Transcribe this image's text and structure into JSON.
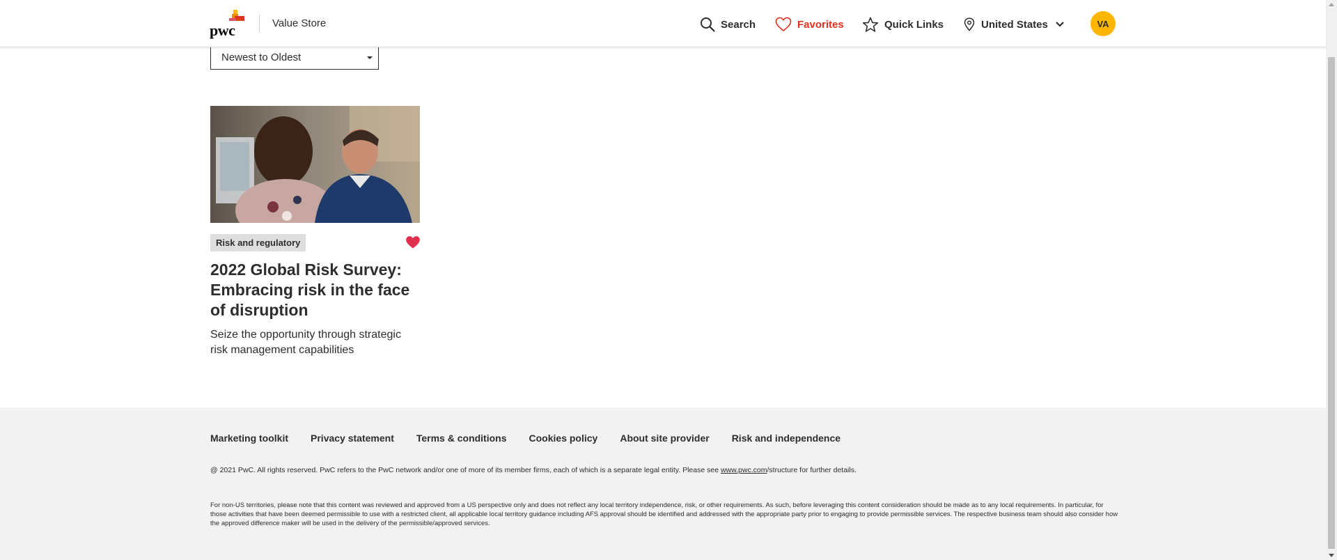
{
  "header": {
    "logo_text": "pwc",
    "store_name": "Value Store",
    "nav": {
      "search_label": "Search",
      "favorites_label": "Favorites",
      "quick_links_label": "Quick Links",
      "country_label": "United States"
    },
    "avatar_initials": "VA",
    "colors": {
      "accent": "#e0301e",
      "avatar": "#ffb600"
    }
  },
  "sort": {
    "selected": "Newest to Oldest"
  },
  "card": {
    "tag": "Risk and regulatory",
    "title": "2022 Global Risk Survey: Embracing risk in the face of disruption",
    "description": "Seize the opportunity through strategic risk management capabilities",
    "favorited": true
  },
  "footer": {
    "links": [
      "Marketing toolkit",
      "Privacy statement",
      "Terms & conditions",
      "Cookies policy",
      "About site provider",
      "Risk and independence"
    ],
    "copyright_before": "@ 2021 PwC. All rights reserved. PwC refers to the PwC network and/or one of more of its member firms, each of which is a separate legal entity. Please see ",
    "copyright_link": "www.pwc.com",
    "copyright_after": "/structure for further details.",
    "disclaimer": "For non-US territories, please note that this content was reviewed and approved from a US perspective only and does not reflect any local territory independence, risk, or other requirements. As such, before leveraging this content consideration should be made as to any local requirements. In particular, for those activities that have been deemed permissible to use with a restricted client, all applicable local territory guidance including AFS approval should be identified and addressed with the appropriate party prior to engaging to provide permissible services. The respective business team should also consider how the approved difference maker will be used in the delivery of the permissible/approved services."
  }
}
